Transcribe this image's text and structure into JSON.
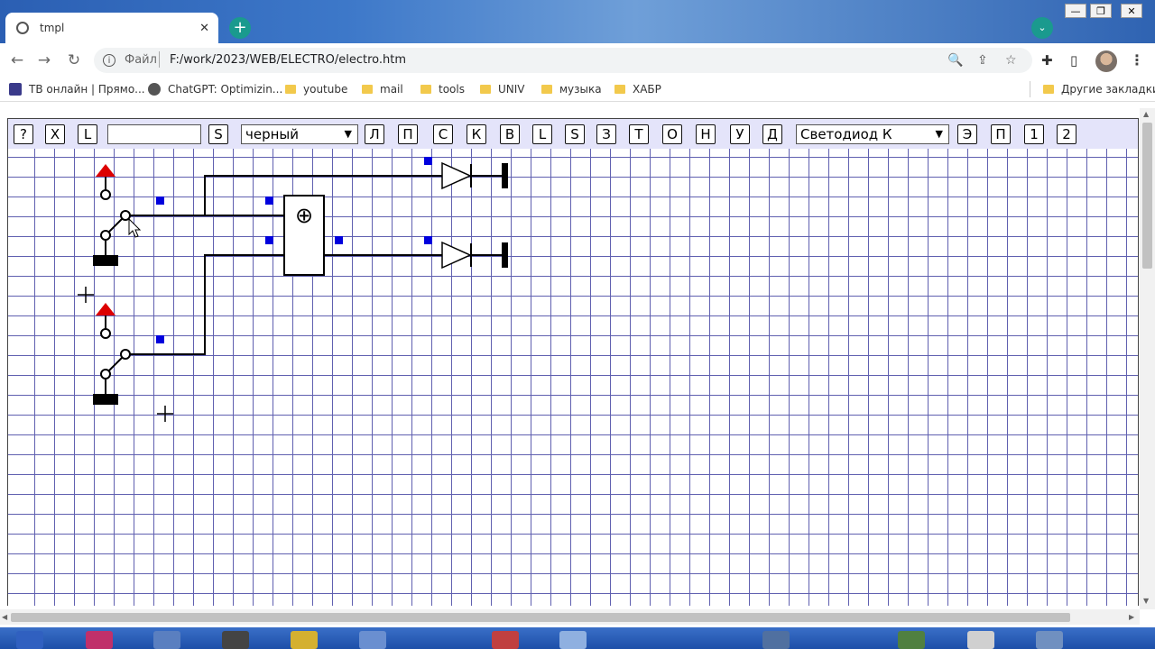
{
  "browser": {
    "tab": {
      "title": "tmpl",
      "close": "✕"
    },
    "new_tab": "+",
    "tab_search": "⌄",
    "window": {
      "minimize": "—",
      "maximize": "❐",
      "close": "✕"
    },
    "nav": {
      "back": "←",
      "forward": "→",
      "reload": "↻"
    },
    "address": {
      "scheme_label": "Файл",
      "url": "F:/work/2023/WEB/ELECTRO/electro.htm",
      "info": "i"
    },
    "omnibox_icons": {
      "zoom": "🔍",
      "share": "⇪",
      "star": "☆"
    },
    "extensions": {
      "puzzle": "✚",
      "sidepanel": "▯",
      "menu": "⋮"
    },
    "bookmarks": [
      {
        "label": "ТВ онлайн | Прямо...",
        "icon": "tv-icon"
      },
      {
        "label": "ChatGPT: Optimizin...",
        "icon": "chatgpt-icon"
      },
      {
        "label": "youtube",
        "icon": "folder-icon"
      },
      {
        "label": "mail",
        "icon": "folder-icon"
      },
      {
        "label": "tools",
        "icon": "folder-icon"
      },
      {
        "label": "UNIV",
        "icon": "folder-icon"
      },
      {
        "label": "музыка",
        "icon": "folder-icon"
      },
      {
        "label": "ХАБР",
        "icon": "folder-icon"
      }
    ],
    "other_bookmarks": "Другие закладки"
  },
  "editor": {
    "buttons": {
      "help": "?",
      "x": "X",
      "l1": "L",
      "s1": "S",
      "b_l": "Л",
      "b_p": "П",
      "b_s": "С",
      "b_k": "К",
      "b_v": "В",
      "l2": "L",
      "s2": "S",
      "b_z": "З",
      "b_t": "Т",
      "b_o": "О",
      "b_n": "Н",
      "b_u": "У",
      "b_d": "Д",
      "b_e": "Э",
      "b_p2": "П",
      "b_1": "1",
      "b_2": "2"
    },
    "text_input_value": "",
    "color_select": "черный",
    "component_select": "Светодиод К",
    "caret": "▼"
  },
  "colors": {
    "grid": "#6060b0",
    "wire": "#000000",
    "power_triangle": "#dd0000",
    "connector": "#0000dd",
    "toolbar_bg": "#e4e4fa"
  },
  "circuit": {
    "block_symbol": "⊕"
  },
  "scroll": {
    "up": "▲",
    "down": "▼",
    "left": "◀",
    "right": "▶"
  }
}
